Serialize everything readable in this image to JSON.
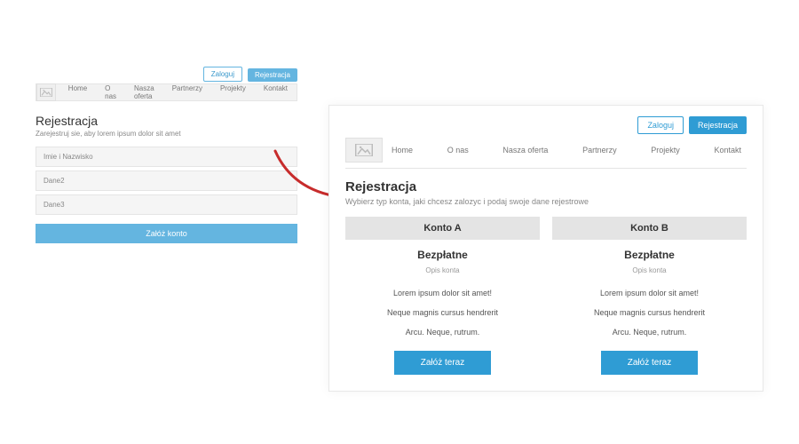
{
  "colors": {
    "accent": "#2f9cd4",
    "accent_light": "#64b5e0"
  },
  "mockup_left": {
    "topbar": {
      "login": "Zaloguj",
      "register": "Rejestracja"
    },
    "nav": [
      "Home",
      "O nas",
      "Nasza oferta",
      "Partnerzy",
      "Projekty",
      "Kontakt"
    ],
    "title": "Rejestracja",
    "subtitle": "Zarejestruj sie, aby lorem ipsum dolor sit amet",
    "fields": [
      {
        "placeholder": "Imie i Nazwisko"
      },
      {
        "placeholder": "Dane2"
      },
      {
        "placeholder": "Dane3"
      }
    ],
    "submit": "Załóż konto"
  },
  "mockup_right": {
    "topbar": {
      "login": "Zaloguj",
      "register": "Rejestracja"
    },
    "nav": [
      "Home",
      "O nas",
      "Nasza oferta",
      "Partnerzy",
      "Projekty",
      "Kontakt"
    ],
    "title": "Rejestracja",
    "subtitle": "Wybierz typ konta, jaki chcesz zalozyc i podaj swoje dane rejestrowe",
    "plans": [
      {
        "name": "Konto A",
        "price": "Bezpłatne",
        "desc": "Opis konta",
        "lines": [
          "Lorem ipsum dolor sit amet!",
          "Neque magnis cursus hendrerit",
          "Arcu. Neque, rutrum."
        ],
        "cta": "Załóż teraz"
      },
      {
        "name": "Konto B",
        "price": "Bezpłatne",
        "desc": "Opis konta",
        "lines": [
          "Lorem ipsum dolor sit amet!",
          "Neque magnis cursus hendrerit",
          "Arcu. Neque, rutrum."
        ],
        "cta": "Załóż teraz"
      }
    ]
  }
}
